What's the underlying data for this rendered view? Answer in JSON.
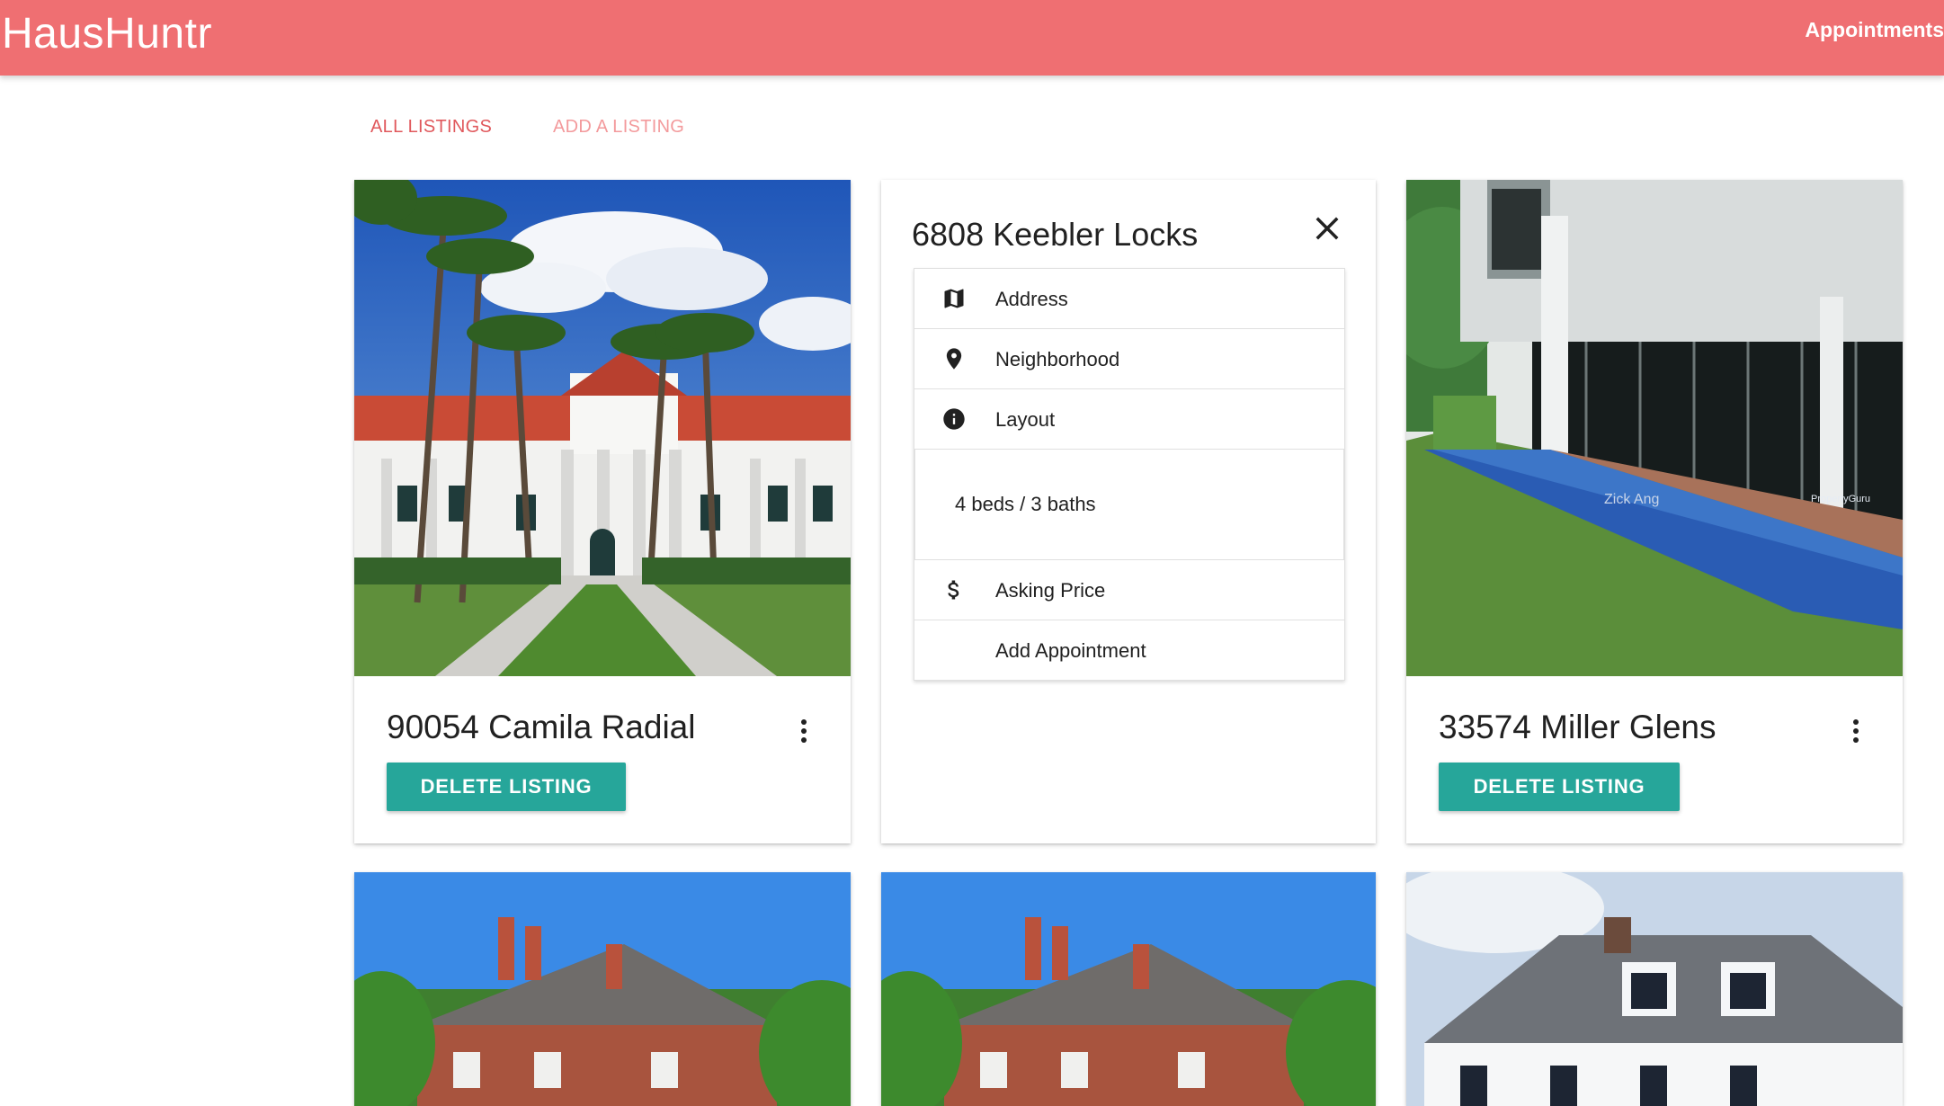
{
  "app": {
    "brand": "HausHuntr",
    "nav_link": "Appointments"
  },
  "tabs": [
    {
      "label": "ALL LISTINGS"
    },
    {
      "label": "ADD A LISTING"
    }
  ],
  "listings": [
    {
      "title": "90054 Camila Radial",
      "button": "DELETE LISTING"
    },
    {
      "title": "6808 Keebler Locks",
      "details": [
        {
          "icon": "map-icon",
          "label": "Address"
        },
        {
          "icon": "location-pin-icon",
          "label": "Neighborhood"
        },
        {
          "icon": "info-icon",
          "label": "Layout"
        },
        {
          "icon": "",
          "label": "4 beds / 3 baths"
        },
        {
          "icon": "dollar-icon",
          "label": "Asking Price"
        },
        {
          "icon": "",
          "label": "Add Appointment"
        }
      ]
    },
    {
      "title": "33574 Miller Glens",
      "button": "DELETE LISTING",
      "photo_watermark": "Zick Ang",
      "photo_brand": "PropertyGuru"
    }
  ],
  "colors": {
    "appbar": "#ef6f72",
    "button": "#26a69a",
    "tab_active": "#e0585c",
    "tab_inactive": "#f39a9c"
  }
}
